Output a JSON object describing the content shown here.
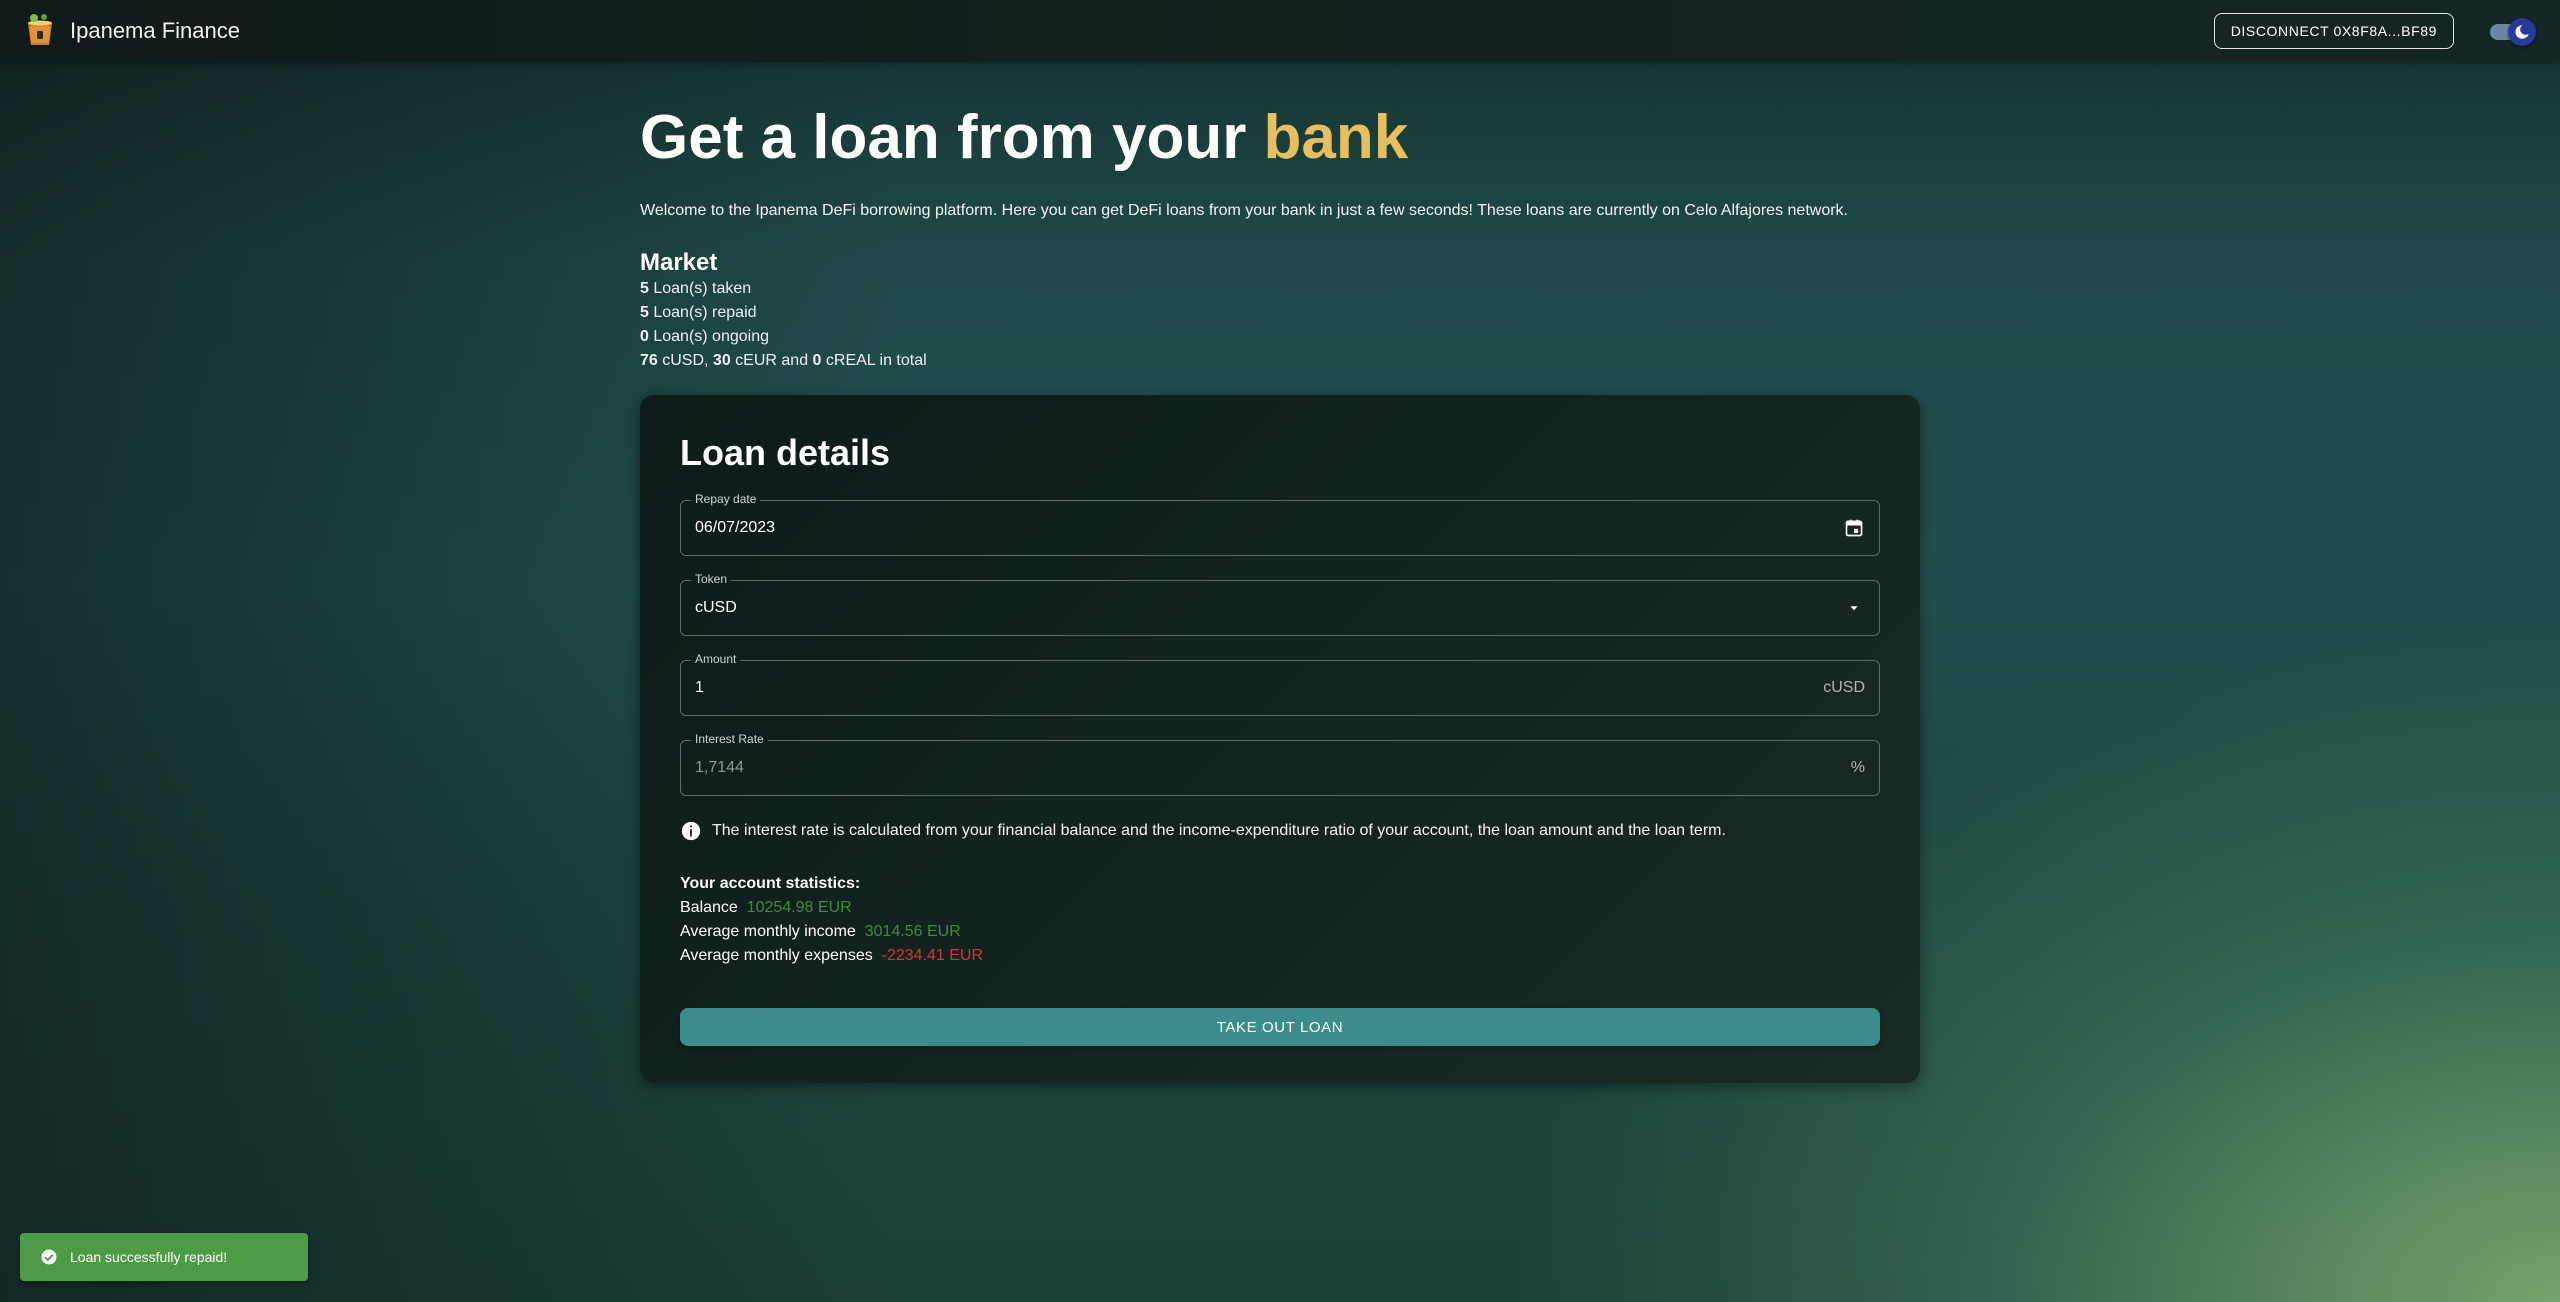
{
  "header": {
    "brand": "Ipanema Finance",
    "disconnect_label": "DISCONNECT 0X8F8A...BF89",
    "theme_mode": "dark"
  },
  "hero": {
    "title_main": "Get a loan from your ",
    "title_accent": "bank",
    "intro": "Welcome to the Ipanema DeFi borrowing platform. Here you can get DeFi loans from your bank in just a few seconds! These loans are currently on Celo Alfajores network."
  },
  "market": {
    "heading": "Market",
    "loans_taken_count": "5",
    "loans_taken_label": " Loan(s) taken",
    "loans_repaid_count": "5",
    "loans_repaid_label": " Loan(s) repaid",
    "loans_ongoing_count": "0",
    "loans_ongoing_label": " Loan(s) ongoing",
    "total_cusd": "76",
    "total_cusd_unit": " cUSD, ",
    "total_ceur": "30",
    "total_ceur_unit": " cEUR and ",
    "total_creal": "0",
    "total_creal_unit": " cREAL in total"
  },
  "loan": {
    "heading": "Loan details",
    "repay_date_label": "Repay date",
    "repay_date_value": "06/07/2023",
    "token_label": "Token",
    "token_value": "cUSD",
    "amount_label": "Amount",
    "amount_value": "1",
    "amount_suffix": "cUSD",
    "interest_label": "Interest Rate",
    "interest_value": "1,7144",
    "interest_suffix": "%",
    "info_text": "The interest rate is calculated from your financial balance and the income-expenditure ratio of your account, the loan amount and the loan term.",
    "submit_label": "TAKE OUT LOAN"
  },
  "stats": {
    "title": "Your account statistics:",
    "balance_label": "Balance",
    "balance_value": "10254.98 EUR",
    "income_label": "Average monthly income",
    "income_value": "3014.56 EUR",
    "expenses_label": "Average monthly expenses",
    "expenses_value": "-2234.41 EUR"
  },
  "toast": {
    "message": "Loan successfully repaid!"
  },
  "colors": {
    "accent_yellow": "#e8bf5f",
    "button_teal": "#3a8d8a",
    "positive_green": "#3e8d3d",
    "negative_red": "#e0312e",
    "toast_green": "#4d9a47"
  },
  "icons": {
    "logo": "cocktail-logo-icon",
    "theme": "moon-icon",
    "calendar": "calendar-icon",
    "dropdown": "chevron-down-icon",
    "info": "info-icon",
    "success": "check-circle-icon"
  }
}
